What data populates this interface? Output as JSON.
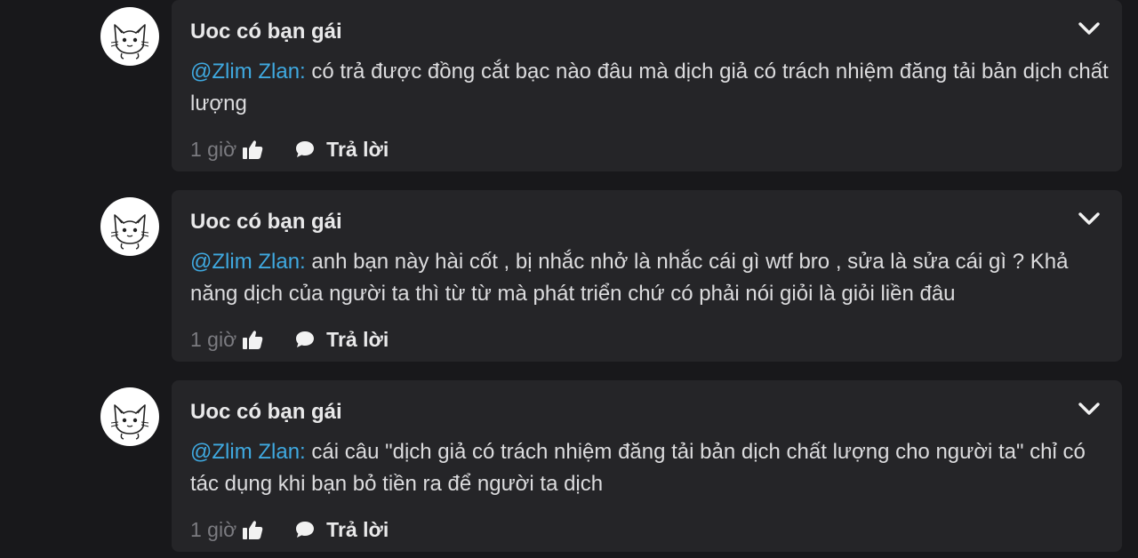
{
  "comments": [
    {
      "author": "Uoc có bạn gái",
      "mention": "@Zlim Zlan:",
      "text": " có trả được đồng cắt bạc nào đâu mà dịch giả có trách nhiệm đăng tải bản dịch chất lượng",
      "time": "1 giờ",
      "reply_label": "Trả lời"
    },
    {
      "author": "Uoc có bạn gái",
      "mention": "@Zlim Zlan:",
      "text": " anh bạn này hài cốt , bị nhắc nhở là nhắc cái gì wtf bro , sửa là sửa cái gì ? Khả năng dịch của người ta thì từ từ mà phát triển chứ có phải nói giỏi là giỏi liền đâu",
      "time": "1 giờ",
      "reply_label": "Trả lời"
    },
    {
      "author": "Uoc có bạn gái",
      "mention": "@Zlim Zlan:",
      "text": " cái câu \"dịch giả có trách nhiệm đăng tải bản dịch chất lượng cho người ta\" chỉ có tác dụng khi bạn bỏ tiền ra để người ta dịch",
      "time": "1 giờ",
      "reply_label": "Trả lời"
    }
  ],
  "icons": {
    "avatar": "cat-avatar-icon",
    "menu": "chevron-down-icon",
    "like": "thumbs-up-icon",
    "reply": "speech-bubble-icon"
  },
  "colors": {
    "background": "#18181b",
    "card": "#252528",
    "mention": "#3fa9e0",
    "muted": "#7b7b80",
    "text": "#dcdcde"
  }
}
